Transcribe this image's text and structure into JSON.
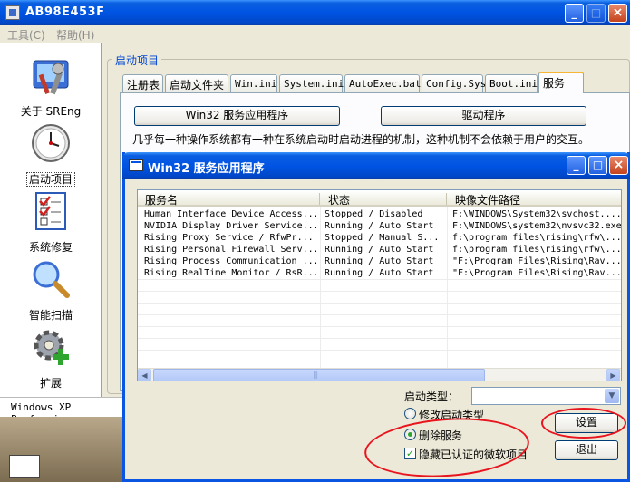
{
  "main_window": {
    "title": "AB98E453F",
    "menu": [
      {
        "label": "工具(C)"
      },
      {
        "label": "帮助(H)"
      }
    ],
    "sidebar": [
      {
        "label": "关于 SREng",
        "icon": "tools-icon"
      },
      {
        "label": "启动项目",
        "icon": "clock-icon",
        "selected": true
      },
      {
        "label": "系统修复",
        "icon": "checklist-icon"
      },
      {
        "label": "智能扫描",
        "icon": "magnifier-icon"
      },
      {
        "label": "扩展",
        "icon": "gear-plus-icon"
      }
    ],
    "status_text": "Windows XP Profession",
    "group_title": "启动项目",
    "tabs": [
      {
        "label": "注册表"
      },
      {
        "label": "启动文件夹"
      },
      {
        "label": "Win.ini"
      },
      {
        "label": "System.ini"
      },
      {
        "label": "AutoExec.bat"
      },
      {
        "label": "Config.Sys"
      },
      {
        "label": "Boot.ini"
      },
      {
        "label": "服务",
        "active": true
      }
    ],
    "buttons": {
      "win32_services": "Win32 服务应用程序",
      "drivers": "驱动程序"
    },
    "description": "几乎每一种操作系统都有一种在系统启动时启动进程的机制，这种机制不会依赖于用户的交互。"
  },
  "dialog": {
    "title": "Win32 服务应用程序",
    "columns": [
      "服务名",
      "状态",
      "映像文件路径"
    ],
    "rows": [
      [
        "Human Interface Device Access...",
        "Stopped / Disabled",
        "F:\\WINDOWS\\System32\\svchost...."
      ],
      [
        "NVIDIA Display Driver Service...",
        "Running / Auto Start",
        "F:\\WINDOWS\\system32\\nvsvc32.exe"
      ],
      [
        "Rising Proxy  Service / RfwPr...",
        "Stopped / Manual S...",
        "f:\\program files\\rising\\rfw\\..."
      ],
      [
        "Rising Personal Firewall Serv...",
        "Running / Auto Start",
        "f:\\program files\\rising\\rfw\\..."
      ],
      [
        "Rising Process Communication ...",
        "Running / Auto Start",
        "\"F:\\Program Files\\Rising\\Rav..."
      ],
      [
        "Rising RealTime Monitor / RsR...",
        "Running / Auto Start",
        "\"F:\\Program Files\\Rising\\Rav..."
      ]
    ],
    "startup_type_label": "启动类型：",
    "startup_type_value": "",
    "radio_modify": "修改启动类型",
    "radio_delete": "删除服务",
    "checkbox_hide_ms": "隐藏已认证的微软项目",
    "radio_selected": "delete",
    "checkbox_checked": true,
    "settings_button": "设置",
    "exit_button": "退出"
  },
  "colors": {
    "titlebar_blue": "#0054e3",
    "annotation_red": "#e8141e",
    "group_title": "#0046d5"
  }
}
